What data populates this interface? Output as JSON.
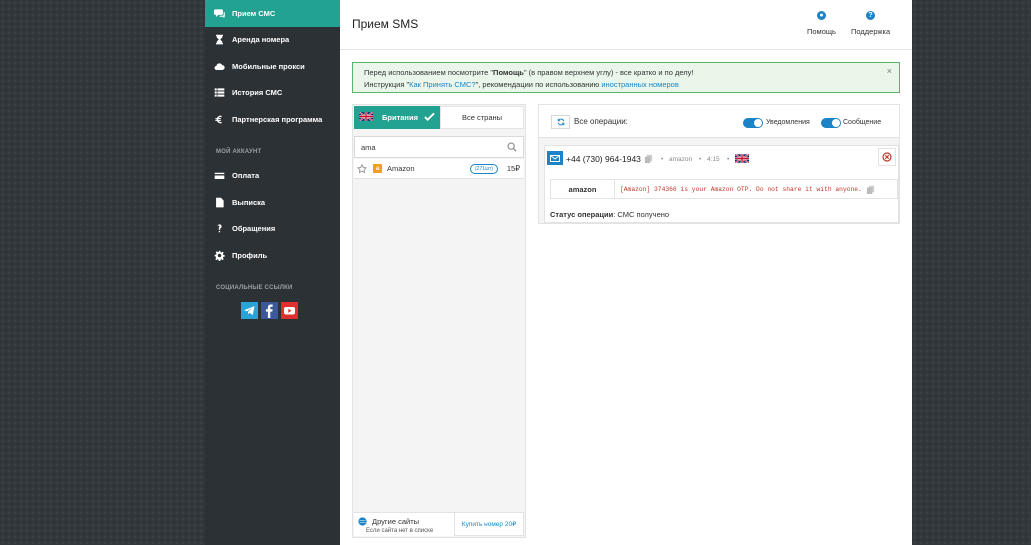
{
  "sidebar": {
    "items": [
      {
        "label": "Прием СМС",
        "icon": "chat-icon",
        "active": true
      },
      {
        "label": "Аренда номера",
        "icon": "hourglass-icon"
      },
      {
        "label": "Мобильные прокси",
        "icon": "cloud-icon"
      },
      {
        "label": "История СМС",
        "icon": "list-icon"
      },
      {
        "label": "Партнерская программа",
        "icon": "euro-icon"
      }
    ],
    "account_title": "МОЙ АККАУНТ",
    "account_items": [
      {
        "label": "Оплата",
        "icon": "card-icon"
      },
      {
        "label": "Выписка",
        "icon": "document-icon"
      },
      {
        "label": "Обращения",
        "icon": "question-icon"
      },
      {
        "label": "Профиль",
        "icon": "gear-icon"
      }
    ],
    "social_title": "СОЦИАЛЬНЫЕ ССЫЛКИ",
    "socials": [
      "telegram-icon",
      "facebook-icon",
      "youtube-icon"
    ]
  },
  "header": {
    "title": "Прием SMS",
    "help_label": "Помощь",
    "support_label": "Поддержка"
  },
  "notice": {
    "line1_pre": "Перед использованием посмотрите \"",
    "line1_bold": "Помощь",
    "line1_post": "\" (в правом верхнем углу) - все кратко и по делу!",
    "line2_pre": "Инструкция \"",
    "line2_link1": "Как Принять СМС?",
    "line2_mid": "\", рекомендации по использованию ",
    "line2_link2": "иностранных номеров",
    "close": "×"
  },
  "left_panel": {
    "country_label": "Британия",
    "all_countries_label": "Все страны",
    "search_value": "ama",
    "services": [
      {
        "name": "Amazon",
        "logo_letter": "a",
        "qty": "(271шт)",
        "price": "15₽"
      }
    ],
    "other_sites_label": "Другие сайты",
    "other_sites_hint": "Если сайта нет в списке",
    "buy_button_label": "Купить номер 20₽"
  },
  "right_panel": {
    "all_ops_label": "Все операции:",
    "notifications_label": "Уведомления",
    "message_label": "Сообщение",
    "operation": {
      "phone": "+44 (730) 964-1943",
      "service": "amazon",
      "time": "4:15",
      "sender": "amazon",
      "sms_text": "[Amazon] 374366 is your Amazon OTP. Do not share it with anyone.",
      "status_label": "Статус операции",
      "status_value": ": СМС получено"
    }
  },
  "colors": {
    "accent": "#22a290",
    "link": "#1c84c6",
    "sidebar_bg": "#2c3136",
    "sms_text": "#c0392b"
  }
}
